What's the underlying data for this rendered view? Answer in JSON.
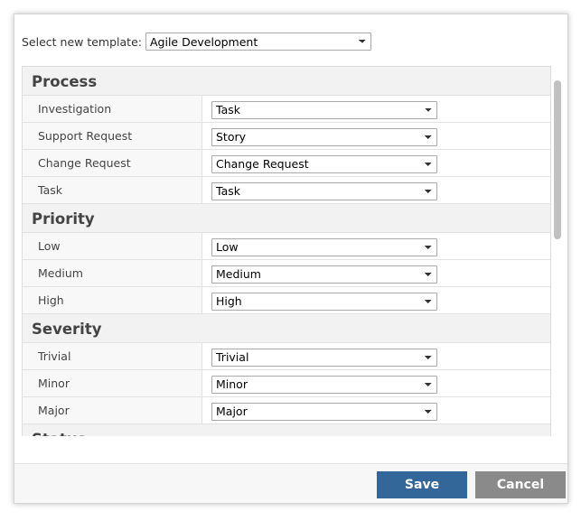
{
  "template": {
    "label": "Select new template:",
    "selected": "Agile Development"
  },
  "sections": [
    {
      "title": "Process",
      "rows": [
        {
          "name": "Investigation",
          "value": "Task"
        },
        {
          "name": "Support Request",
          "value": "Story"
        },
        {
          "name": "Change Request",
          "value": "Change Request"
        },
        {
          "name": "Task",
          "value": "Task"
        }
      ]
    },
    {
      "title": "Priority",
      "rows": [
        {
          "name": "Low",
          "value": "Low"
        },
        {
          "name": "Medium",
          "value": "Medium"
        },
        {
          "name": "High",
          "value": "High"
        }
      ]
    },
    {
      "title": "Severity",
      "rows": [
        {
          "name": "Trivial",
          "value": "Trivial"
        },
        {
          "name": "Minor",
          "value": "Minor"
        },
        {
          "name": "Major",
          "value": "Major"
        }
      ]
    },
    {
      "title": "Status",
      "rows": []
    }
  ],
  "footer": {
    "save_label": "Save",
    "cancel_label": "Cancel"
  },
  "colors": {
    "save_button": "#336699",
    "cancel_button": "#8a8a8a",
    "section_header_bg": "#f2f2f2"
  }
}
